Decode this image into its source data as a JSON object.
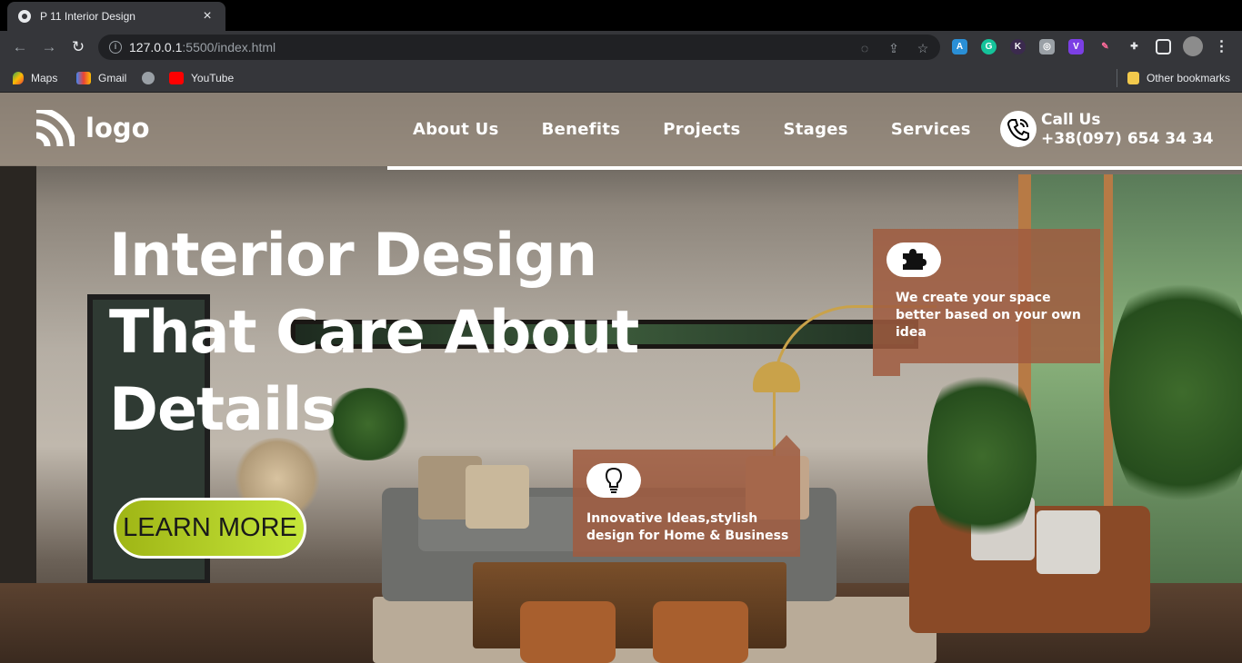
{
  "browser": {
    "tab_title": "P 11 Interior Design",
    "url_host": "127.0.0.1",
    "url_path": ":5500/index.html",
    "bookmarks": [
      {
        "label": "Maps"
      },
      {
        "label": "Gmail"
      },
      {
        "label": ""
      },
      {
        "label": "YouTube"
      }
    ],
    "other_bookmarks": "Other bookmarks"
  },
  "header": {
    "logo_text": "logo",
    "nav": [
      "About Us",
      "Benefits",
      "Projects",
      "Stages",
      "Services"
    ],
    "call_label": "Call Us",
    "call_number": "+38(097) 654 34 34"
  },
  "hero": {
    "title_lines": [
      "Interior Design",
      "That Care About",
      "Details"
    ],
    "cta_label": "LEARN MORE"
  },
  "cards": [
    {
      "icon": "puzzle-icon",
      "text": "We create your space better based on your own idea"
    },
    {
      "icon": "lightbulb-icon",
      "text": "Innovative Ideas,stylish design for Home & Business"
    }
  ],
  "colors": {
    "header_bg": "#a09385",
    "card_bg": "#a05c40",
    "cta_gradient_start": "#9fb515",
    "cta_gradient_end": "#c5e63a"
  }
}
